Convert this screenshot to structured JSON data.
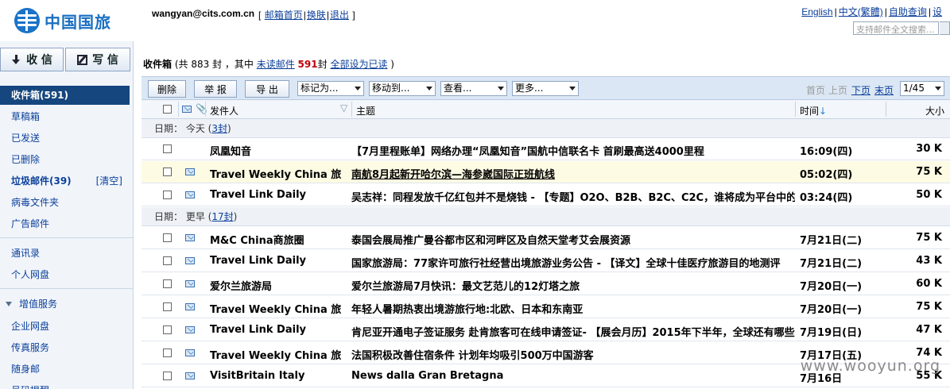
{
  "header": {
    "logo_text": "中国国旅",
    "user_email": "wangyan@cits.com.cn",
    "links_open": "[",
    "links": [
      "邮箱首页",
      "换肤",
      "退出"
    ],
    "links_sep": "|",
    "links_close": "]",
    "right_links": [
      "English",
      "中文(繁體)",
      "自助查询",
      "设"
    ],
    "search_placeholder": "支持邮件全文搜索..."
  },
  "sidebar": {
    "receive_label": "收 信",
    "write_label": "写 信",
    "items": [
      {
        "label": "收件箱(591)"
      },
      {
        "label": "草稿箱"
      },
      {
        "label": "已发送"
      },
      {
        "label": "已删除"
      },
      {
        "label": "垃圾邮件(39)"
      },
      {
        "label": "病毒文件夹"
      },
      {
        "label": "广告邮件"
      },
      {
        "label": "通讯录"
      },
      {
        "label": "个人网盘"
      },
      {
        "label": "增值服务"
      },
      {
        "label": "企业网盘"
      },
      {
        "label": "传真服务"
      },
      {
        "label": "随身邮"
      },
      {
        "label": "号码提醒"
      }
    ],
    "clear_label": "[清空]"
  },
  "main": {
    "folder_title": "收件箱",
    "summary_pre": "(共 883 封 ，其中",
    "unread_link": "未读邮件",
    "unread_count": "591",
    "summary_mid": "封",
    "mark_all_link": "全部设为已读",
    "summary_end": ")",
    "toolbar": {
      "delete_label": "删除",
      "report_label": "举 报",
      "export_label": "导 出",
      "mark_as": "标记为...",
      "move_to": "移动到...",
      "view": "查看...",
      "more": "更多..."
    },
    "pager": {
      "first": "首页",
      "prev": "上页",
      "next": "下页",
      "last": "末页",
      "page": "1/45"
    },
    "columns": {
      "sender": "发件人",
      "subject": "主题",
      "time": "时间",
      "size": "大小"
    },
    "groups": [
      {
        "label_pre": "日期： 今天 (",
        "count": "3封",
        "label_post": ")"
      },
      {
        "label_pre": "日期： 更早 (",
        "count": "17封",
        "label_post": ")"
      }
    ],
    "mails": [
      {
        "sender": "凤凰知音",
        "subject": "【7月里程账单】网络办理“凤凰知音”国航中信联名卡 首刷最高送4000里程",
        "time": "16:09(四)",
        "size": "30 K"
      },
      {
        "sender": "Travel Weekly China 旅",
        "subject": "南航8月起新开哈尔滨—海参崴国际正班航线",
        "time": "05:02(四)",
        "size": "75 K"
      },
      {
        "sender": "Travel Link Daily",
        "subject": "吴志祥：同程发放千亿红包并不是烧钱 - 【专题】O2O、B2B、B2C、C2C，谁将成为平台中的下一个",
        "time": "03:24(四)",
        "size": "50 K"
      },
      {
        "sender": "M&C China商旅圈",
        "subject": "泰国会展局推广曼谷都市区和河畔区及自然天堂考艾会展资源",
        "time": "7月21日(二)",
        "size": "75 K"
      },
      {
        "sender": "Travel Link Daily",
        "subject": "国家旅游局：77家许可旅行社经营出境旅游业务公告 - 【译文】全球十佳医疗旅游目的地测评",
        "time": "7月21日(二)",
        "size": "43 K"
      },
      {
        "sender": "爱尔兰旅游局",
        "subject": "爱尔兰旅游局7月快讯：最文艺范儿的12灯塔之旅",
        "time": "7月20日(一)",
        "size": "60 K"
      },
      {
        "sender": "Travel Weekly China 旅",
        "subject": "年轻人暑期热衷出境游旅行地:北欧、日本和东南亚",
        "time": "7月20日(一)",
        "size": "75 K"
      },
      {
        "sender": "Travel Link Daily",
        "subject": "肯尼亚开通电子签证服务 赴肯旅客可在线申请签证- 【展会月历】2015年下半年，全球还有哪些旅游展",
        "time": "7月19日(日)",
        "size": "47 K"
      },
      {
        "sender": "Travel Weekly China 旅",
        "subject": "法国积极改善住宿条件 计划年均吸引500万中国游客",
        "time": "7月17日(五)",
        "size": "74 K"
      },
      {
        "sender": "VisitBritain Italy",
        "subject": "News dalla Gran Bretagna",
        "time": "7月16日",
        "size": "55 K"
      }
    ]
  },
  "watermark": "www.wooyun.org"
}
